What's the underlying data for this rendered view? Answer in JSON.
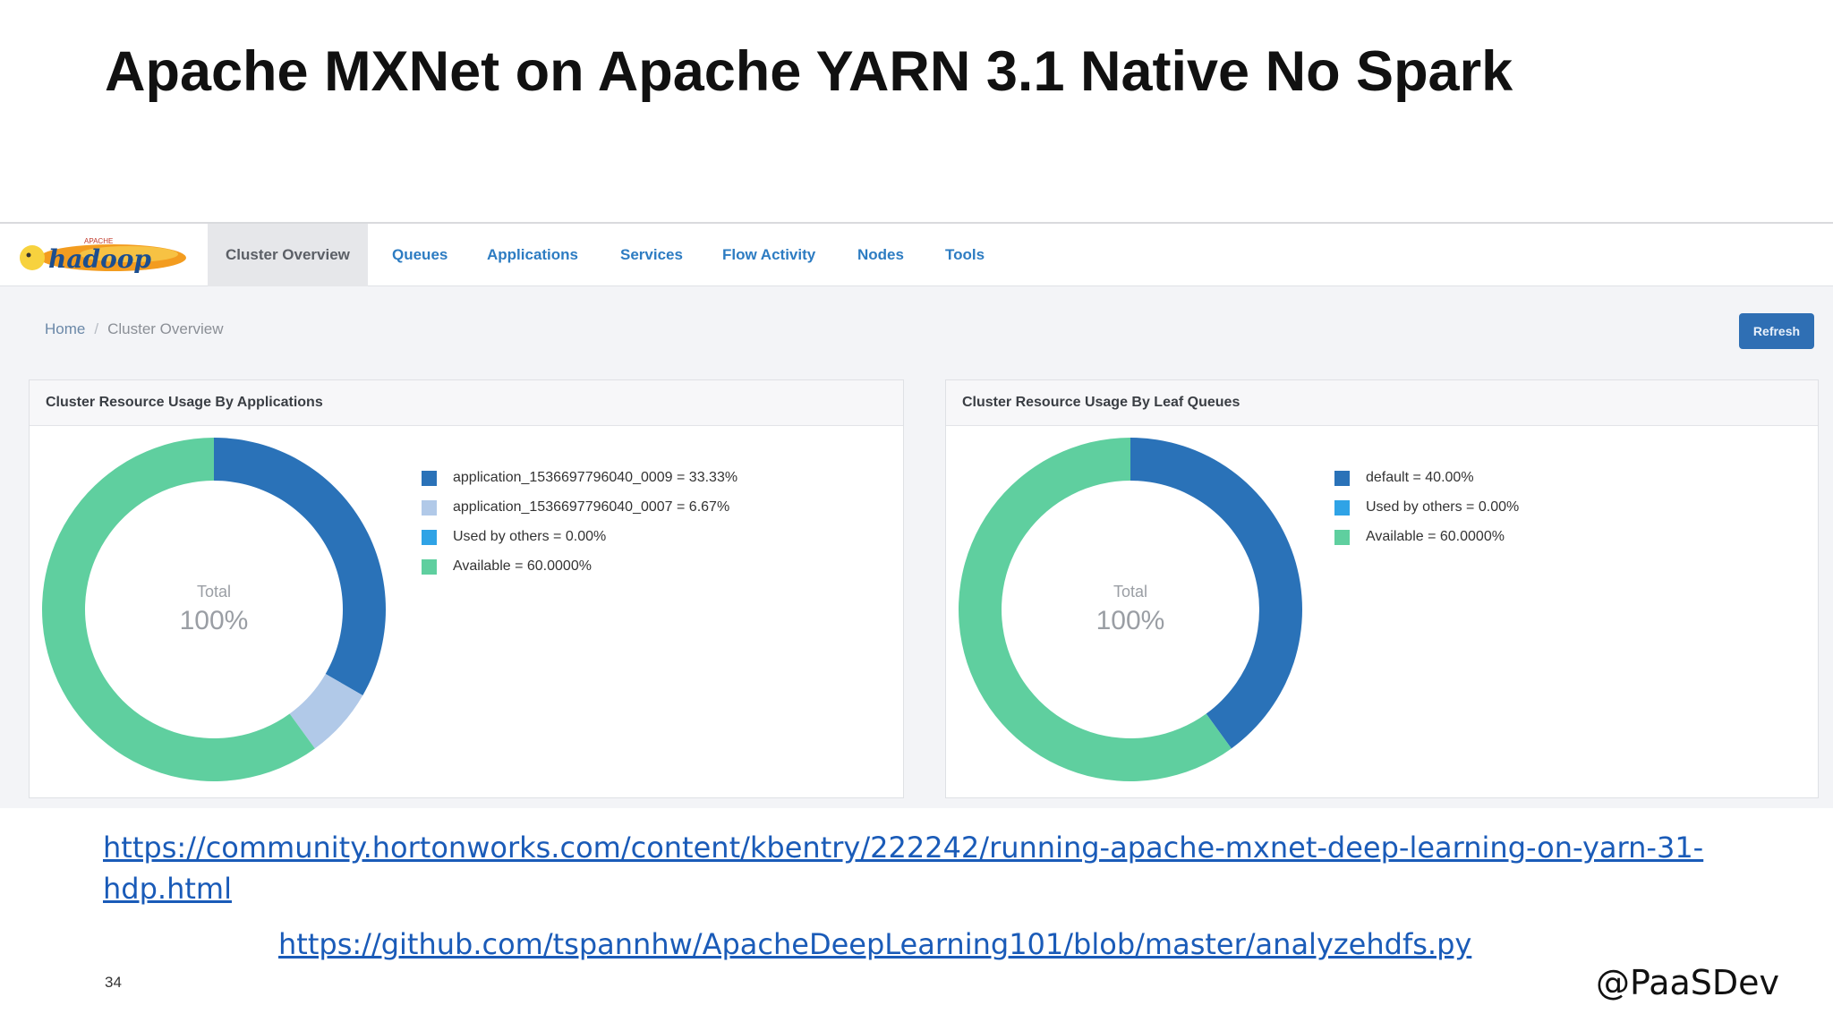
{
  "slide": {
    "title": "Apache MXNet on Apache YARN 3.1 Native No Spark",
    "page_number": "34",
    "handle": "@PaaSDev"
  },
  "links": [
    {
      "line1": "https://community.hortonworks.com/content/kbentry/222242/running-apache-mxnet-deep-learning-on-yarn-31-",
      "line2": "hdp.html"
    },
    {
      "line1": "https://github.com/tspannhw/ApacheDeepLearning101/blob/master/analyzehdfs.py"
    }
  ],
  "app": {
    "logo_alt": "Apache Hadoop",
    "nav": [
      {
        "label": "Cluster Overview",
        "active": true
      },
      {
        "label": "Queues"
      },
      {
        "label": "Applications"
      },
      {
        "label": "Services"
      },
      {
        "label": "Flow Activity"
      },
      {
        "label": "Nodes"
      },
      {
        "label": "Tools"
      }
    ],
    "breadcrumb": {
      "home": "Home",
      "separator": "/",
      "current": "Cluster Overview"
    },
    "refresh_label": "Refresh",
    "colors": {
      "dark_blue": "#2a72b8",
      "light_blue": "#b1c9e8",
      "sky_blue": "#2fa3e6",
      "green": "#5fcf9f",
      "link": "#1a5bb8"
    }
  },
  "panels": [
    {
      "title": "Cluster Resource Usage By Applications",
      "center_label": "Total",
      "center_value": "100%",
      "legend": [
        {
          "label": "application_1536697796040_0009 = 33.33%",
          "color": "#2a72b8"
        },
        {
          "label": "application_1536697796040_0007 = 6.67%",
          "color": "#b1c9e8"
        },
        {
          "label": "Used by others = 0.00%",
          "color": "#2fa3e6"
        },
        {
          "label": "Available = 60.0000%",
          "color": "#5fcf9f"
        }
      ],
      "slices": [
        {
          "value": 33.33,
          "color": "#2a72b8"
        },
        {
          "value": 6.67,
          "color": "#b1c9e8"
        },
        {
          "value": 0,
          "color": "#2fa3e6"
        },
        {
          "value": 60.0,
          "color": "#5fcf9f"
        }
      ]
    },
    {
      "title": "Cluster Resource Usage By Leaf Queues",
      "center_label": "Total",
      "center_value": "100%",
      "legend": [
        {
          "label": "default = 40.00%",
          "color": "#2a72b8"
        },
        {
          "label": "Used by others = 0.00%",
          "color": "#2fa3e6"
        },
        {
          "label": "Available = 60.0000%",
          "color": "#5fcf9f"
        }
      ],
      "slices": [
        {
          "value": 40.0,
          "color": "#2a72b8"
        },
        {
          "value": 0,
          "color": "#2fa3e6"
        },
        {
          "value": 60.0,
          "color": "#5fcf9f"
        }
      ]
    }
  ]
}
